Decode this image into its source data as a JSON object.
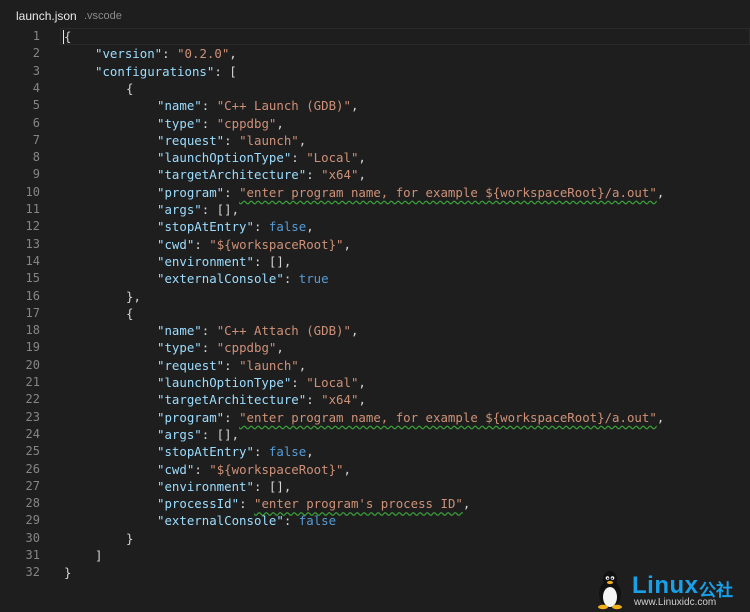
{
  "tab": {
    "title": "launch.json",
    "path": ".vscode"
  },
  "lines": [
    {
      "n": "1",
      "indent": 0,
      "tokens": [
        {
          "t": "{",
          "c": "p"
        }
      ]
    },
    {
      "n": "2",
      "indent": 1,
      "tokens": [
        {
          "t": "\"version\"",
          "c": "k"
        },
        {
          "t": ": ",
          "c": "p"
        },
        {
          "t": "\"0.2.0\"",
          "c": "s"
        },
        {
          "t": ",",
          "c": "p"
        }
      ]
    },
    {
      "n": "3",
      "indent": 1,
      "tokens": [
        {
          "t": "\"configurations\"",
          "c": "k"
        },
        {
          "t": ": [",
          "c": "p"
        }
      ]
    },
    {
      "n": "4",
      "indent": 2,
      "tokens": [
        {
          "t": "{",
          "c": "p"
        }
      ]
    },
    {
      "n": "5",
      "indent": 3,
      "tokens": [
        {
          "t": "\"name\"",
          "c": "k"
        },
        {
          "t": ": ",
          "c": "p"
        },
        {
          "t": "\"C++ Launch (GDB)\"",
          "c": "s"
        },
        {
          "t": ",",
          "c": "p"
        }
      ]
    },
    {
      "n": "6",
      "indent": 3,
      "tokens": [
        {
          "t": "\"type\"",
          "c": "k"
        },
        {
          "t": ": ",
          "c": "p"
        },
        {
          "t": "\"cppdbg\"",
          "c": "s"
        },
        {
          "t": ",",
          "c": "p"
        }
      ]
    },
    {
      "n": "7",
      "indent": 3,
      "tokens": [
        {
          "t": "\"request\"",
          "c": "k"
        },
        {
          "t": ": ",
          "c": "p"
        },
        {
          "t": "\"launch\"",
          "c": "s"
        },
        {
          "t": ",",
          "c": "p"
        }
      ]
    },
    {
      "n": "8",
      "indent": 3,
      "tokens": [
        {
          "t": "\"launchOptionType\"",
          "c": "k"
        },
        {
          "t": ": ",
          "c": "p"
        },
        {
          "t": "\"Local\"",
          "c": "s"
        },
        {
          "t": ",",
          "c": "p"
        }
      ]
    },
    {
      "n": "9",
      "indent": 3,
      "tokens": [
        {
          "t": "\"targetArchitecture\"",
          "c": "k"
        },
        {
          "t": ": ",
          "c": "p"
        },
        {
          "t": "\"x64\"",
          "c": "s"
        },
        {
          "t": ",",
          "c": "p"
        }
      ]
    },
    {
      "n": "10",
      "indent": 3,
      "tokens": [
        {
          "t": "\"program\"",
          "c": "k"
        },
        {
          "t": ": ",
          "c": "p"
        },
        {
          "t": "\"enter program name, for example ${workspaceRoot}/a.out\"",
          "c": "s",
          "sq": true
        },
        {
          "t": ",",
          "c": "p"
        }
      ]
    },
    {
      "n": "11",
      "indent": 3,
      "tokens": [
        {
          "t": "\"args\"",
          "c": "k"
        },
        {
          "t": ": [],",
          "c": "p"
        }
      ]
    },
    {
      "n": "12",
      "indent": 3,
      "tokens": [
        {
          "t": "\"stopAtEntry\"",
          "c": "k"
        },
        {
          "t": ": ",
          "c": "p"
        },
        {
          "t": "false",
          "c": "b"
        },
        {
          "t": ",",
          "c": "p"
        }
      ]
    },
    {
      "n": "13",
      "indent": 3,
      "tokens": [
        {
          "t": "\"cwd\"",
          "c": "k"
        },
        {
          "t": ": ",
          "c": "p"
        },
        {
          "t": "\"${workspaceRoot}\"",
          "c": "s"
        },
        {
          "t": ",",
          "c": "p"
        }
      ]
    },
    {
      "n": "14",
      "indent": 3,
      "tokens": [
        {
          "t": "\"environment\"",
          "c": "k"
        },
        {
          "t": ": [],",
          "c": "p"
        }
      ]
    },
    {
      "n": "15",
      "indent": 3,
      "tokens": [
        {
          "t": "\"externalConsole\"",
          "c": "k"
        },
        {
          "t": ": ",
          "c": "p"
        },
        {
          "t": "true",
          "c": "b"
        }
      ]
    },
    {
      "n": "16",
      "indent": 2,
      "tokens": [
        {
          "t": "},",
          "c": "p"
        }
      ]
    },
    {
      "n": "17",
      "indent": 2,
      "tokens": [
        {
          "t": "{",
          "c": "p"
        }
      ]
    },
    {
      "n": "18",
      "indent": 3,
      "tokens": [
        {
          "t": "\"name\"",
          "c": "k"
        },
        {
          "t": ": ",
          "c": "p"
        },
        {
          "t": "\"C++ Attach (GDB)\"",
          "c": "s"
        },
        {
          "t": ",",
          "c": "p"
        }
      ]
    },
    {
      "n": "19",
      "indent": 3,
      "tokens": [
        {
          "t": "\"type\"",
          "c": "k"
        },
        {
          "t": ": ",
          "c": "p"
        },
        {
          "t": "\"cppdbg\"",
          "c": "s"
        },
        {
          "t": ",",
          "c": "p"
        }
      ]
    },
    {
      "n": "20",
      "indent": 3,
      "tokens": [
        {
          "t": "\"request\"",
          "c": "k"
        },
        {
          "t": ": ",
          "c": "p"
        },
        {
          "t": "\"launch\"",
          "c": "s"
        },
        {
          "t": ",",
          "c": "p"
        }
      ]
    },
    {
      "n": "21",
      "indent": 3,
      "tokens": [
        {
          "t": "\"launchOptionType\"",
          "c": "k"
        },
        {
          "t": ": ",
          "c": "p"
        },
        {
          "t": "\"Local\"",
          "c": "s"
        },
        {
          "t": ",",
          "c": "p"
        }
      ]
    },
    {
      "n": "22",
      "indent": 3,
      "tokens": [
        {
          "t": "\"targetArchitecture\"",
          "c": "k"
        },
        {
          "t": ": ",
          "c": "p"
        },
        {
          "t": "\"x64\"",
          "c": "s"
        },
        {
          "t": ",",
          "c": "p"
        }
      ]
    },
    {
      "n": "23",
      "indent": 3,
      "tokens": [
        {
          "t": "\"program\"",
          "c": "k"
        },
        {
          "t": ": ",
          "c": "p"
        },
        {
          "t": "\"enter program name, for example ${workspaceRoot}/a.out\"",
          "c": "s",
          "sq": true
        },
        {
          "t": ",",
          "c": "p"
        }
      ]
    },
    {
      "n": "24",
      "indent": 3,
      "tokens": [
        {
          "t": "\"args\"",
          "c": "k"
        },
        {
          "t": ": [],",
          "c": "p"
        }
      ]
    },
    {
      "n": "25",
      "indent": 3,
      "tokens": [
        {
          "t": "\"stopAtEntry\"",
          "c": "k"
        },
        {
          "t": ": ",
          "c": "p"
        },
        {
          "t": "false",
          "c": "b"
        },
        {
          "t": ",",
          "c": "p"
        }
      ]
    },
    {
      "n": "26",
      "indent": 3,
      "tokens": [
        {
          "t": "\"cwd\"",
          "c": "k"
        },
        {
          "t": ": ",
          "c": "p"
        },
        {
          "t": "\"${workspaceRoot}\"",
          "c": "s"
        },
        {
          "t": ",",
          "c": "p"
        }
      ]
    },
    {
      "n": "27",
      "indent": 3,
      "tokens": [
        {
          "t": "\"environment\"",
          "c": "k"
        },
        {
          "t": ": [],",
          "c": "p"
        }
      ]
    },
    {
      "n": "28",
      "indent": 3,
      "tokens": [
        {
          "t": "\"processId\"",
          "c": "k"
        },
        {
          "t": ": ",
          "c": "p"
        },
        {
          "t": "\"enter program's process ID\"",
          "c": "s",
          "sq": true
        },
        {
          "t": ",",
          "c": "p"
        }
      ]
    },
    {
      "n": "29",
      "indent": 3,
      "tokens": [
        {
          "t": "\"externalConsole\"",
          "c": "k"
        },
        {
          "t": ": ",
          "c": "p"
        },
        {
          "t": "false",
          "c": "b"
        }
      ]
    },
    {
      "n": "30",
      "indent": 2,
      "tokens": [
        {
          "t": "}",
          "c": "p"
        }
      ]
    },
    {
      "n": "31",
      "indent": 1,
      "tokens": [
        {
          "t": "]",
          "c": "p"
        }
      ]
    },
    {
      "n": "32",
      "indent": 0,
      "tokens": [
        {
          "t": "}",
          "c": "p"
        }
      ]
    }
  ],
  "watermark": {
    "brand": "Linux",
    "brand_cn": "公社",
    "url": "www.Linuxidc.com"
  },
  "colors": {
    "background": "#1e1e1e",
    "key": "#9cdcfe",
    "string": "#ce9178",
    "boolean": "#569cd6",
    "punctuation": "#d4d4d4",
    "line_number": "#858585",
    "squiggle": "#3a9b3a",
    "watermark": "#18a0e8"
  }
}
